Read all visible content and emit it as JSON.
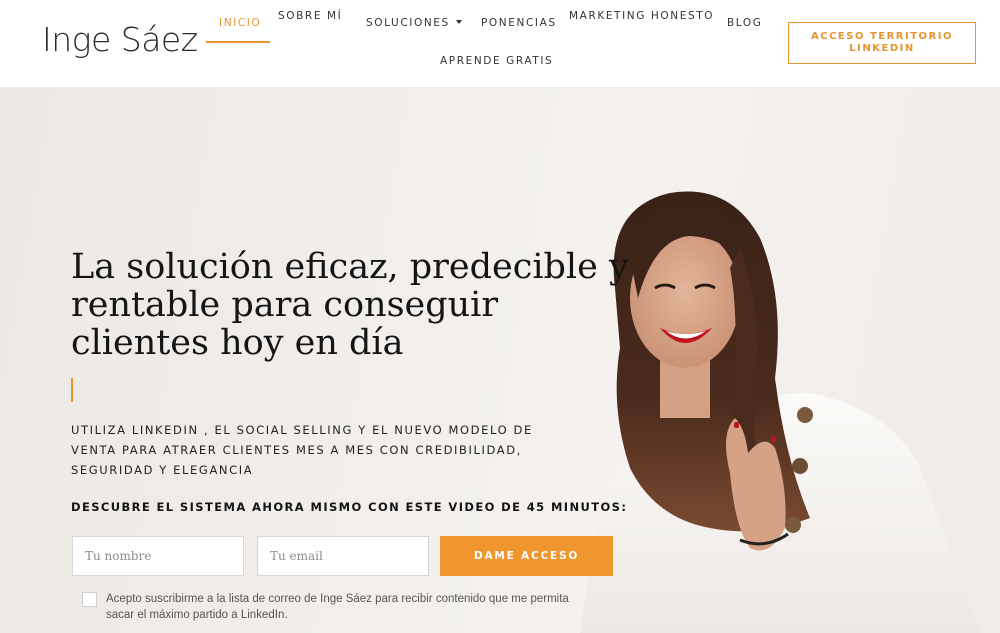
{
  "header": {
    "logo": "Inge Sáez",
    "nav": [
      {
        "label": "Inicio",
        "active": true
      },
      {
        "label": "Sobre mí"
      },
      {
        "label": "Soluciones",
        "has_dropdown": true
      },
      {
        "label": "Ponencias"
      },
      {
        "label": "Marketing Honesto"
      },
      {
        "label": "Blog"
      },
      {
        "label": "Aprende gratis"
      }
    ],
    "cta": "ACCESO TERRITORIO LINKEDIN"
  },
  "hero": {
    "title": "La solución eficaz, predecible y rentable para conseguir clientes hoy en día",
    "subtitle": "UTILIZA LINKEDIN , EL SOCIAL SELLING Y EL NUEVO MODELO DE VENTA PARA ATRAER CLIENTES MES A MES CON CREDIBILIDAD, SEGURIDAD Y ELEGANCIA",
    "cta_text": "DESCUBRE EL SISTEMA AHORA MISMO CON ESTE VIDEO DE 45 MINUTOS:",
    "form": {
      "name_placeholder": "Tu nombre",
      "email_placeholder": "Tu email",
      "submit_label": "DAME ACCESO",
      "consent_text": "Acepto suscribirme a la lista de correo de Inge Sáez para recibir contenido que me permita sacar el máximo partido a LinkedIn.",
      "consent_checked": false
    }
  },
  "colors": {
    "accent": "#e8942f",
    "button": "#f0962f",
    "hero_bg": "#f1eeeb",
    "text": "#141414"
  }
}
